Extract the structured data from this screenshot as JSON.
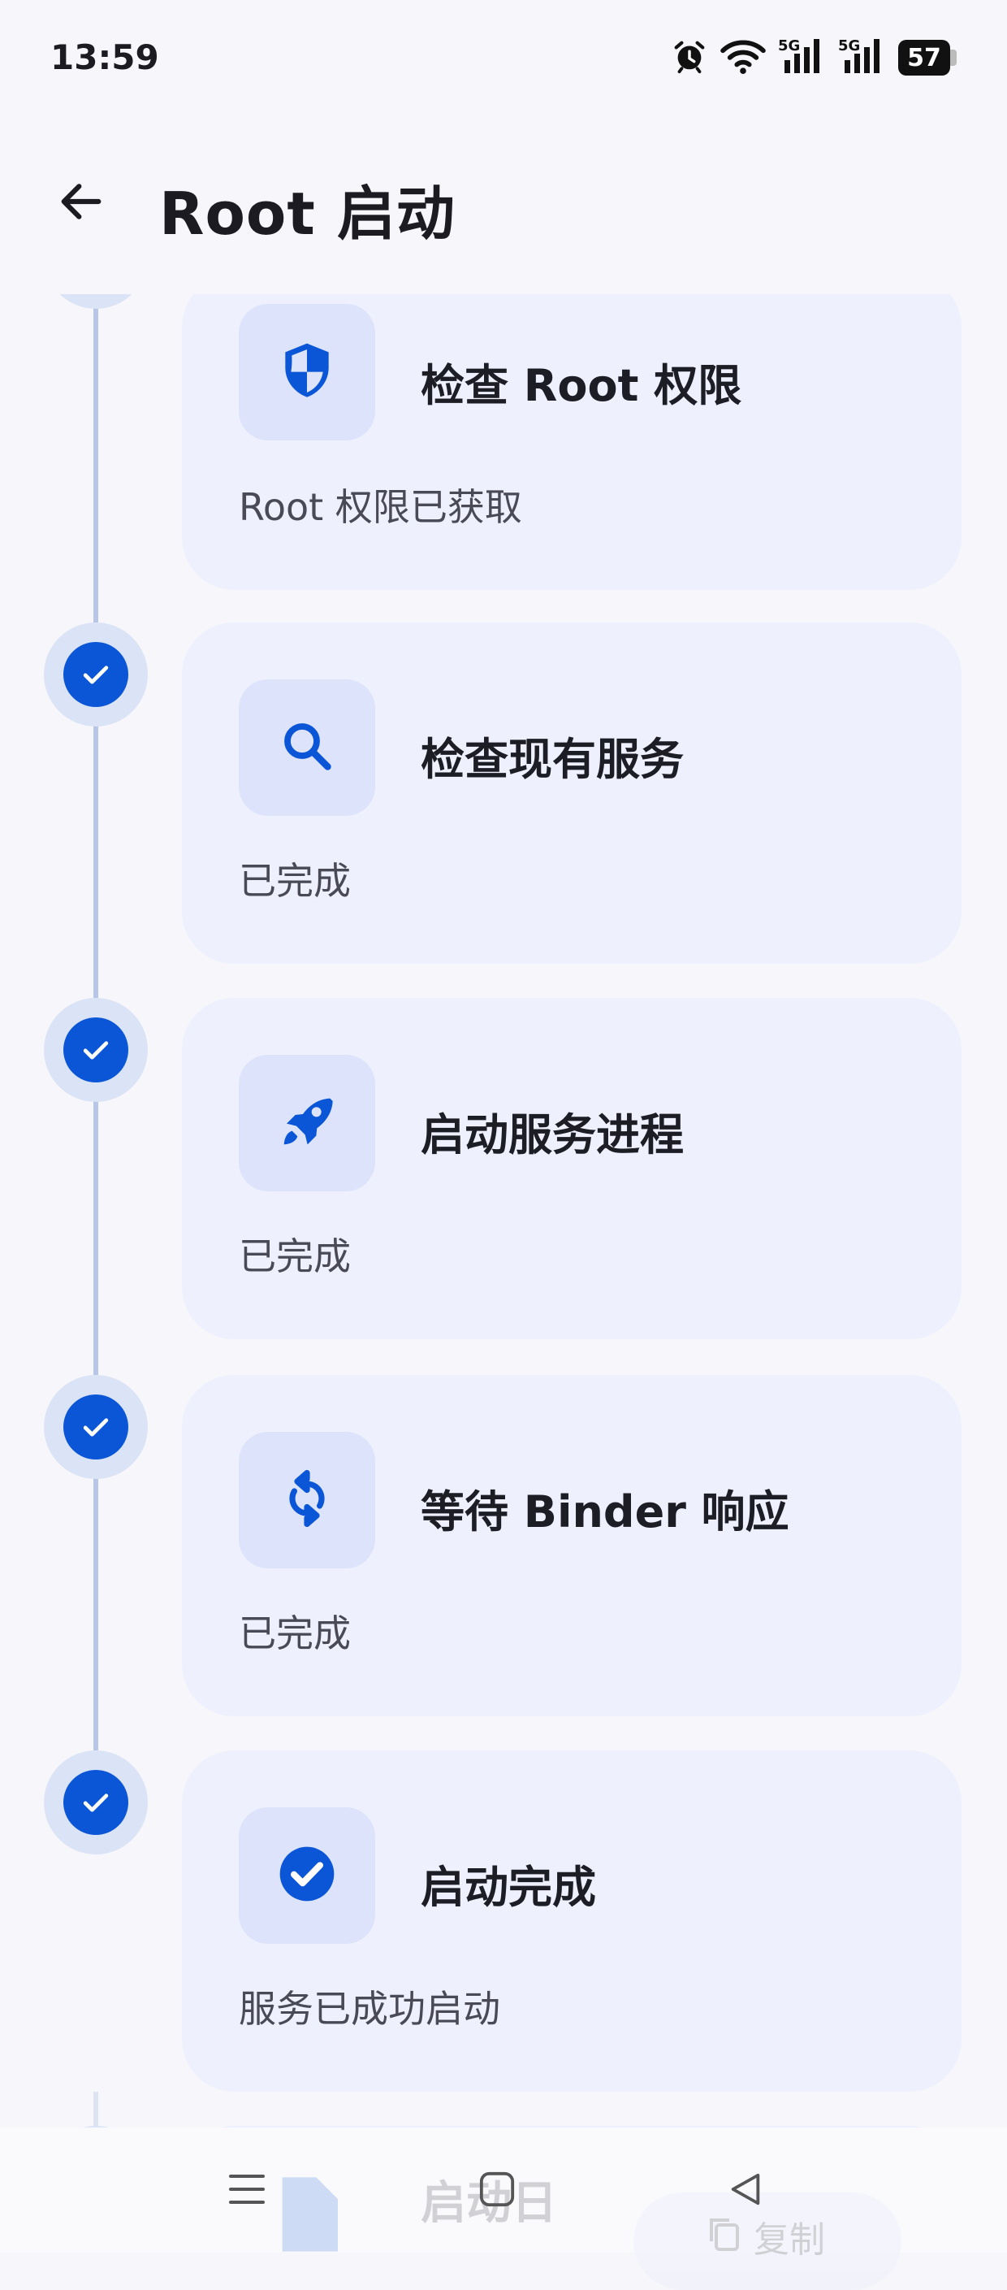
{
  "status_bar": {
    "time": "13:59",
    "battery": "57",
    "icons": [
      "alarm-icon",
      "wifi-icon",
      "signal-5g-icon",
      "signal-5g-icon",
      "battery-icon"
    ]
  },
  "app_bar": {
    "title": "Root 启动",
    "back_icon": "arrow-back-icon"
  },
  "steps": [
    {
      "title": "检查 Root 权限",
      "description": "Root 权限已获取",
      "icon": "shield-icon",
      "status": "done"
    },
    {
      "title": "检查现有服务",
      "description": "已完成",
      "icon": "search-icon",
      "status": "done"
    },
    {
      "title": "启动服务进程",
      "description": "已完成",
      "icon": "rocket-icon",
      "status": "done"
    },
    {
      "title": "等待 Binder 响应",
      "description": "已完成",
      "icon": "sync-icon",
      "status": "done"
    },
    {
      "title": "启动完成",
      "description": "服务已成功启动",
      "icon": "check-circle-icon",
      "status": "done"
    }
  ],
  "partial_step": {
    "title": "启动日",
    "copy_label": "复制"
  },
  "colors": {
    "accent": "#0a56d6",
    "card_bg": "#eef0fd",
    "icon_box_bg": "#dce3fb",
    "timeline": "#b7c6e8"
  }
}
